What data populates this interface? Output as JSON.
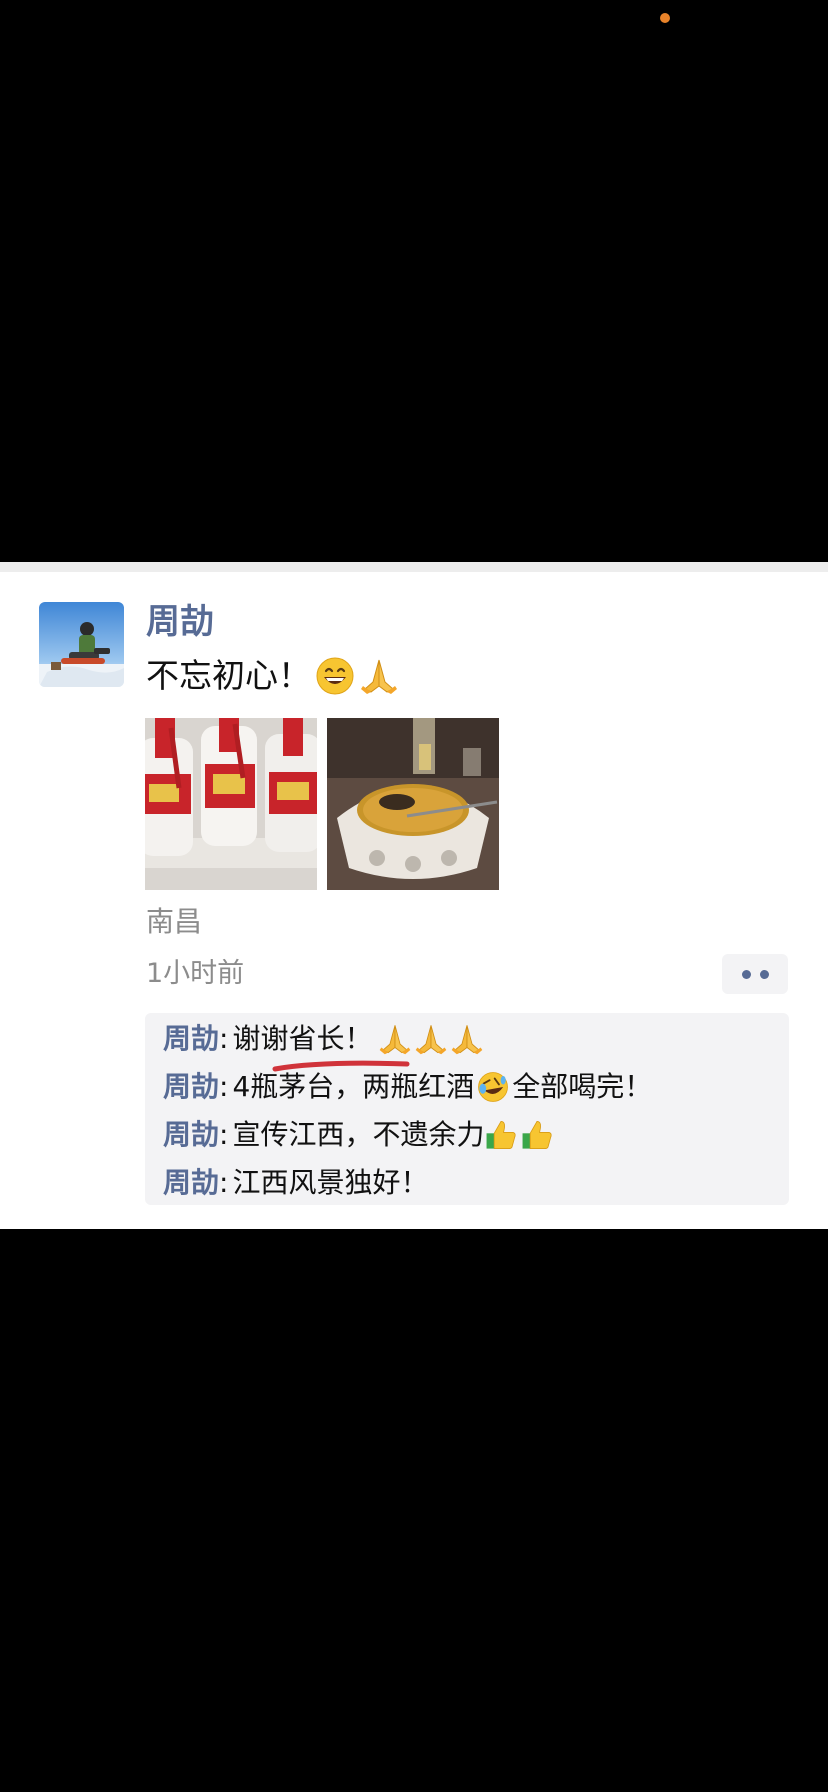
{
  "post": {
    "author": "周劼",
    "text": "不忘初心！",
    "text_emojis": [
      "grinning-face-emoji",
      "folded-hands-emoji"
    ],
    "location": "南昌",
    "timestamp": "1小时前"
  },
  "comments": [
    {
      "author": "周劼",
      "separator": ":",
      "text": "谢谢省长！",
      "emojis": [
        "folded-hands-emoji",
        "folded-hands-emoji",
        "folded-hands-emoji"
      ]
    },
    {
      "author": "周劼",
      "separator": ":",
      "text": "4瓶茅台，两瓶红酒",
      "emoji_mid": "rolling-laughing-emoji",
      "text_after": " 全部喝完！"
    },
    {
      "author": "周劼",
      "separator": ":",
      "text": "宣传江西，不遗余力",
      "emojis": [
        "thumbs-up-emoji",
        "thumbs-up-emoji"
      ]
    },
    {
      "author": "周劼",
      "separator": ":",
      "text": "江西风景独好！"
    }
  ],
  "colors": {
    "name_blue": "#576b95",
    "meta_gray": "#8c8c8c",
    "comment_bg": "#f3f3f5",
    "underline_red": "#d0333a",
    "status_dot": "#e8832a"
  }
}
